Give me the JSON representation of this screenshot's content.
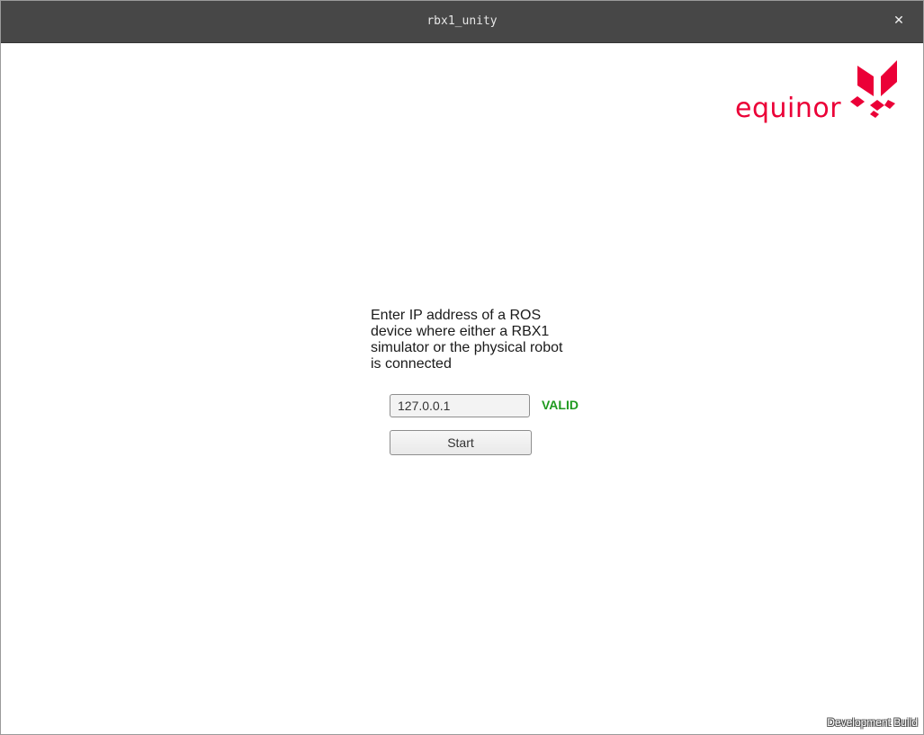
{
  "window": {
    "title": "rbx1_unity",
    "close_icon": "close-icon",
    "close_glyph": "✕"
  },
  "brand": {
    "logo_text": "equinor",
    "color": "#eb0037"
  },
  "form": {
    "prompt": "Enter IP address of a ROS device where either a RBX1 simulator or the physical robot is connected",
    "ip_value": "127.0.0.1",
    "validation_status": "VALID",
    "validation_color": "#1f9a1f",
    "start_label": "Start"
  },
  "footer": {
    "build_label": "Development Build"
  }
}
